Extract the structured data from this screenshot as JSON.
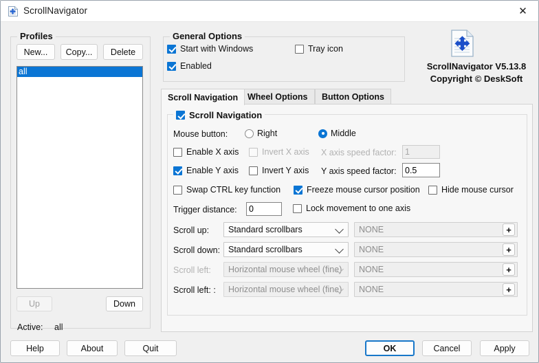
{
  "window": {
    "title": "ScrollNavigator",
    "app_icon": "scrollnavigator-document-icon",
    "close_label": "✕"
  },
  "profiles": {
    "group_title": "Profiles",
    "buttons": {
      "new": "New...",
      "copy": "Copy...",
      "delete": "Delete"
    },
    "items": [
      {
        "label": "all",
        "selected": true
      }
    ],
    "move_up": "Up",
    "move_down": "Down",
    "active_label": "Active:",
    "active_value": "all"
  },
  "general_options": {
    "group_title": "General Options",
    "start_with_windows": {
      "label": "Start with Windows",
      "checked": true
    },
    "enabled": {
      "label": "Enabled",
      "checked": true
    },
    "tray_icon": {
      "label": "Tray icon",
      "checked": false
    }
  },
  "branding": {
    "product_version": "ScrollNavigator V5.13.8",
    "copyright": "Copyright © DeskSoft"
  },
  "tabs": [
    {
      "label": "Scroll Navigation",
      "active": true
    },
    {
      "label": "Wheel Options",
      "active": false
    },
    {
      "label": "Button Options",
      "active": false
    }
  ],
  "scroll_navigation": {
    "group_title": "Scroll Navigation",
    "group_checked": true,
    "mouse_button_label": "Mouse button:",
    "mouse_button_options": [
      {
        "label": "Right",
        "selected": false
      },
      {
        "label": "Middle",
        "selected": true
      }
    ],
    "enable_x_axis": {
      "label": "Enable X axis",
      "checked": false
    },
    "invert_x_axis": {
      "label": "Invert X axis",
      "checked": false,
      "disabled": true
    },
    "x_speed_label": "X axis speed factor:",
    "x_speed_value": "1",
    "enable_y_axis": {
      "label": "Enable Y axis",
      "checked": true
    },
    "invert_y_axis": {
      "label": "Invert Y axis",
      "checked": false
    },
    "y_speed_label": "Y axis speed factor:",
    "y_speed_value": "0.5",
    "swap_ctrl": {
      "label": "Swap CTRL key function",
      "checked": false
    },
    "freeze_cursor": {
      "label": "Freeze mouse cursor position",
      "checked": true
    },
    "hide_cursor": {
      "label": "Hide mouse cursor",
      "checked": false
    },
    "trigger_distance_label": "Trigger distance:",
    "trigger_distance_value": "0",
    "lock_movement": {
      "label": "Lock movement to one axis",
      "checked": false
    },
    "scroll_rows": [
      {
        "label": "Scroll up:",
        "label_disabled": false,
        "method": "Standard scrollbars",
        "method_disabled": false,
        "hotkey": "NONE",
        "add_label": "+"
      },
      {
        "label": "Scroll down:",
        "label_disabled": false,
        "method": "Standard scrollbars",
        "method_disabled": false,
        "hotkey": "NONE",
        "add_label": "+"
      },
      {
        "label": "Scroll left:",
        "label_disabled": true,
        "method": "Horizontal mouse wheel (fine)",
        "method_disabled": true,
        "hotkey": "NONE",
        "add_label": "+"
      },
      {
        "label": "Scroll left: :",
        "label_disabled": false,
        "method": "Horizontal mouse wheel (fine)",
        "method_disabled": true,
        "hotkey": "NONE",
        "add_label": "+"
      }
    ]
  },
  "footer": {
    "help": "Help",
    "about": "About",
    "quit": "Quit",
    "ok": "OK",
    "cancel": "Cancel",
    "apply": "Apply"
  },
  "colors": {
    "accent": "#0a75d4",
    "window_bg": "#f0f0f0",
    "titlebar_bg": "#ffffff",
    "selection": "#0a75d4",
    "default_button_border": "#1777c9"
  }
}
